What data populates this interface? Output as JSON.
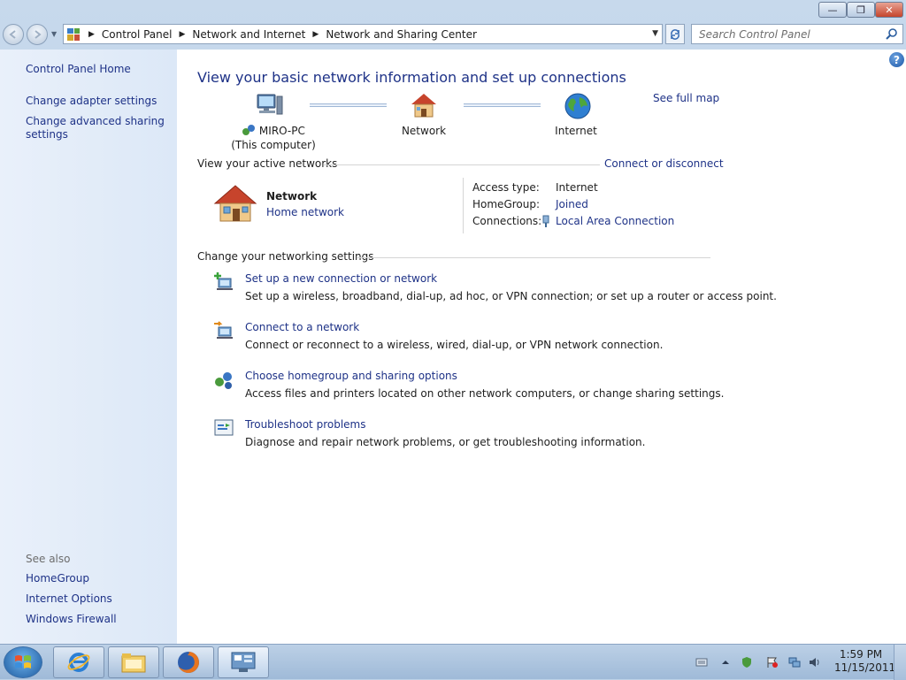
{
  "window": {
    "caption_buttons": {
      "minimize": "—",
      "maximize": "❐",
      "close": "✕"
    }
  },
  "navigation": {
    "breadcrumb": [
      "Control Panel",
      "Network and Internet",
      "Network and Sharing Center"
    ],
    "search_placeholder": "Search Control Panel"
  },
  "sidebar": {
    "home": "Control Panel Home",
    "links": [
      "Change adapter settings",
      "Change advanced sharing settings"
    ],
    "see_also_label": "See also",
    "see_also": [
      "HomeGroup",
      "Internet Options",
      "Windows Firewall"
    ]
  },
  "main": {
    "title": "View your basic network information and set up connections",
    "see_full_map": "See full map",
    "map": {
      "computer_name": "MIRO-PC",
      "computer_sub": "(This computer)",
      "network": "Network",
      "internet": "Internet"
    },
    "active_networks": {
      "heading": "View your active networks",
      "connect_link": "Connect or disconnect",
      "network_name": "Network",
      "network_type": "Home network",
      "access_type_label": "Access type:",
      "access_type_value": "Internet",
      "homegroup_label": "HomeGroup:",
      "homegroup_value": "Joined",
      "connections_label": "Connections:",
      "connections_value": "Local Area Connection"
    },
    "change_settings": {
      "heading": "Change your networking settings",
      "tasks": [
        {
          "title": "Set up a new connection or network",
          "desc": "Set up a wireless, broadband, dial-up, ad hoc, or VPN connection; or set up a router or access point."
        },
        {
          "title": "Connect to a network",
          "desc": "Connect or reconnect to a wireless, wired, dial-up, or VPN network connection."
        },
        {
          "title": "Choose homegroup and sharing options",
          "desc": "Access files and printers located on other network computers, or change sharing settings."
        },
        {
          "title": "Troubleshoot problems",
          "desc": "Diagnose and repair network problems, or get troubleshooting information."
        }
      ]
    }
  },
  "taskbar": {
    "time": "1:59 PM",
    "date": "11/15/2011",
    "pinned": [
      "internet-explorer",
      "windows-explorer",
      "firefox",
      "control-panel"
    ]
  },
  "colors": {
    "link": "#1e3287",
    "title": "#1e3287",
    "sidebar": "#dce8f7"
  }
}
